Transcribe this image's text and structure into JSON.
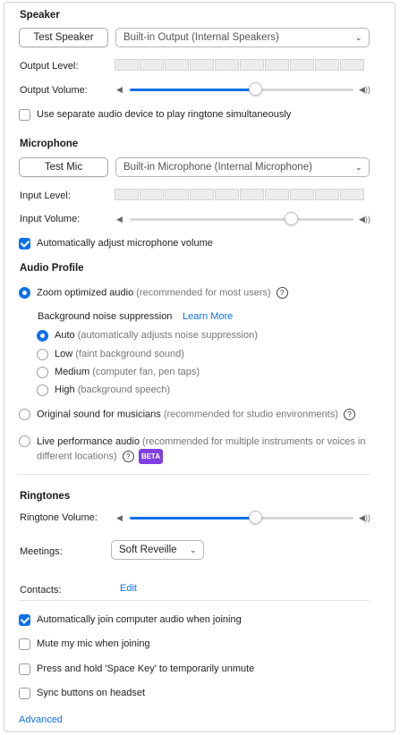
{
  "speaker": {
    "title": "Speaker",
    "test_button": "Test Speaker",
    "device": "Built-in Output (Internal Speakers)",
    "output_level_label": "Output Level:",
    "output_volume_label": "Output Volume:",
    "output_volume_value": 0.56,
    "separate_device_label": "Use separate audio device to play ringtone simultaneously",
    "separate_device_checked": false
  },
  "microphone": {
    "title": "Microphone",
    "test_button": "Test Mic",
    "device": "Built-in Microphone (Internal Microphone)",
    "input_level_label": "Input Level:",
    "input_volume_label": "Input Volume:",
    "input_volume_value": 0.72,
    "auto_adjust_label": "Automatically adjust microphone volume",
    "auto_adjust_checked": true
  },
  "audio_profile": {
    "title": "Audio Profile",
    "zoom_optimized": "Zoom optimized audio",
    "zoom_optimized_note": "(recommended for most users)",
    "bg_noise_label": "Background noise suppression",
    "learn_more": "Learn More",
    "options": [
      {
        "name": "Auto",
        "desc": "(automatically adjusts noise suppression)",
        "selected": true
      },
      {
        "name": "Low",
        "desc": "(faint background sound)",
        "selected": false
      },
      {
        "name": "Medium",
        "desc": "(computer fan, pen taps)",
        "selected": false
      },
      {
        "name": "High",
        "desc": "(background speech)",
        "selected": false
      }
    ],
    "original_sound": "Original sound for musicians",
    "original_sound_note": "(recommended for studio environments)",
    "live_performance": "Live performance audio",
    "live_performance_note": "(recommended for multiple instruments or voices in",
    "live_performance_note2": "different locations)",
    "beta": "BETA"
  },
  "ringtones": {
    "title": "Ringtones",
    "volume_label": "Ringtone Volume:",
    "volume_value": 0.56,
    "meetings_label": "Meetings:",
    "meetings_value": "Soft Reveille",
    "contacts_label": "Contacts:",
    "contacts_edit": "Edit"
  },
  "options": [
    {
      "label": "Automatically join computer audio when joining",
      "checked": true
    },
    {
      "label": "Mute my mic when joining",
      "checked": false
    },
    {
      "label": "Press and hold 'Space Key' to temporarily unmute",
      "checked": false
    },
    {
      "label": "Sync buttons on headset",
      "checked": false
    }
  ],
  "advanced": "Advanced",
  "icons": {
    "speaker_low": "speaker-low-icon",
    "speaker_high": "speaker-high-icon",
    "chevron": "chevron-down-icon",
    "help": "help-icon"
  },
  "colors": {
    "accent": "#0e71eb",
    "beta": "#7f3fe2"
  }
}
